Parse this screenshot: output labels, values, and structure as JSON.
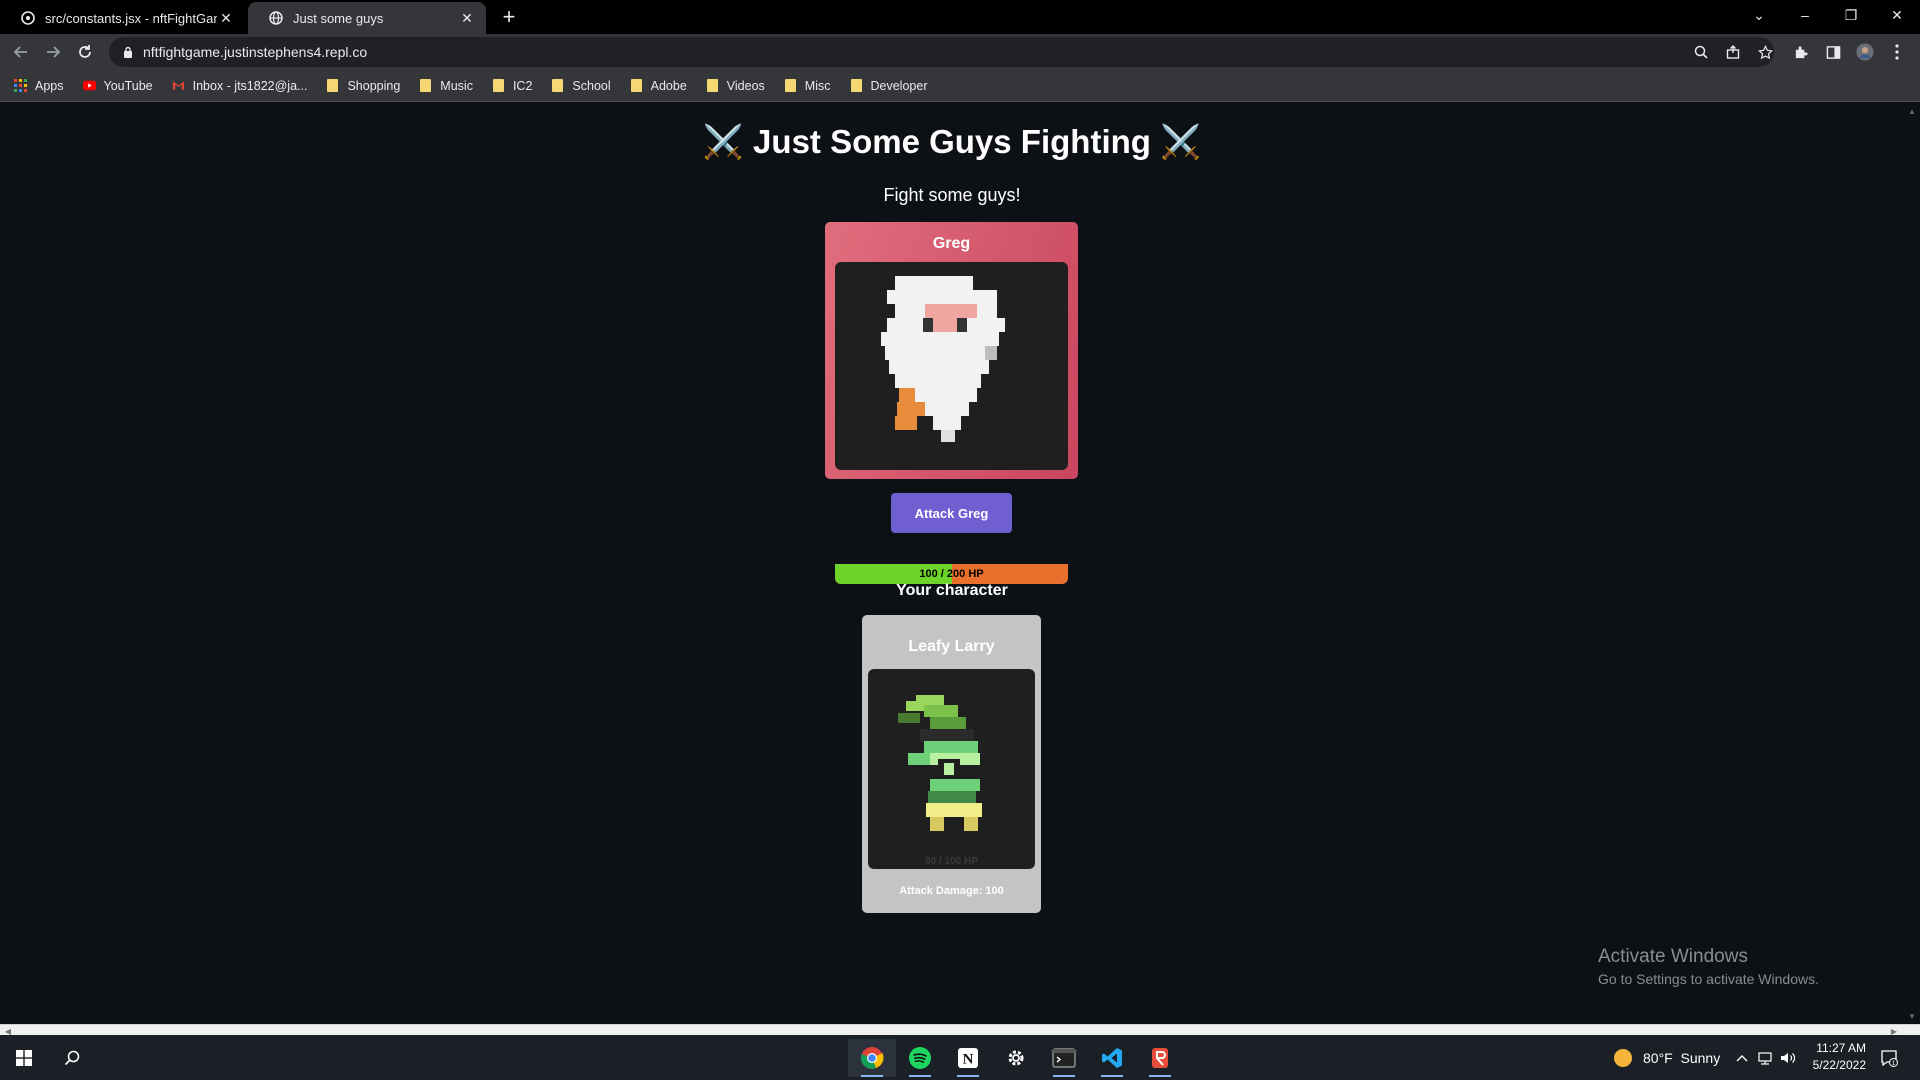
{
  "browser": {
    "tabs": [
      {
        "title": "src/constants.jsx - nftFightGame",
        "active": false
      },
      {
        "title": "Just some guys",
        "active": true
      }
    ],
    "url": "nftfightgame.justinstephens4.repl.co",
    "bookmarks": [
      {
        "label": "Apps",
        "icon": "apps-grid-icon"
      },
      {
        "label": "YouTube",
        "icon": "youtube-icon"
      },
      {
        "label": "Inbox - jts1822@ja...",
        "icon": "gmail-icon"
      },
      {
        "label": "Shopping",
        "icon": "folder-icon"
      },
      {
        "label": "Music",
        "icon": "folder-icon"
      },
      {
        "label": "IC2",
        "icon": "folder-icon"
      },
      {
        "label": "School",
        "icon": "folder-icon"
      },
      {
        "label": "Adobe",
        "icon": "folder-icon"
      },
      {
        "label": "Videos",
        "icon": "folder-icon"
      },
      {
        "label": "Misc",
        "icon": "folder-icon"
      },
      {
        "label": "Developer",
        "icon": "folder-icon"
      }
    ]
  },
  "game": {
    "title": "⚔️ Just Some Guys Fighting ⚔️",
    "subtitle": "Fight some guys!",
    "boss": {
      "name": "Greg",
      "hp_text": "100 / 200 HP",
      "hp_fraction": 0.5,
      "attack_label": "Attack Greg"
    },
    "player_heading": "Your character",
    "player": {
      "name": "Leafy Larry",
      "hp_text": "80 / 100 HP",
      "attack_damage_text": "Attack Damage: 100"
    }
  },
  "watermark": {
    "line1": "Activate Windows",
    "line2": "Go to Settings to activate Windows."
  },
  "taskbar": {
    "apps": [
      "chrome-icon",
      "spotify-icon",
      "notion-icon",
      "settings-icon",
      "terminal-icon",
      "vscode-icon",
      "app-icon"
    ],
    "weather": "80°F  Sunny",
    "time": "11:27 AM",
    "date": "5/22/2022"
  },
  "colors": {
    "page_bg": "#0d1116",
    "boss_card": "#c9455f",
    "hp_fill": "#6fd42a",
    "hp_empty": "#e86f2c",
    "attack_button": "#6f5fd0",
    "player_card": "#c4c4c4"
  }
}
